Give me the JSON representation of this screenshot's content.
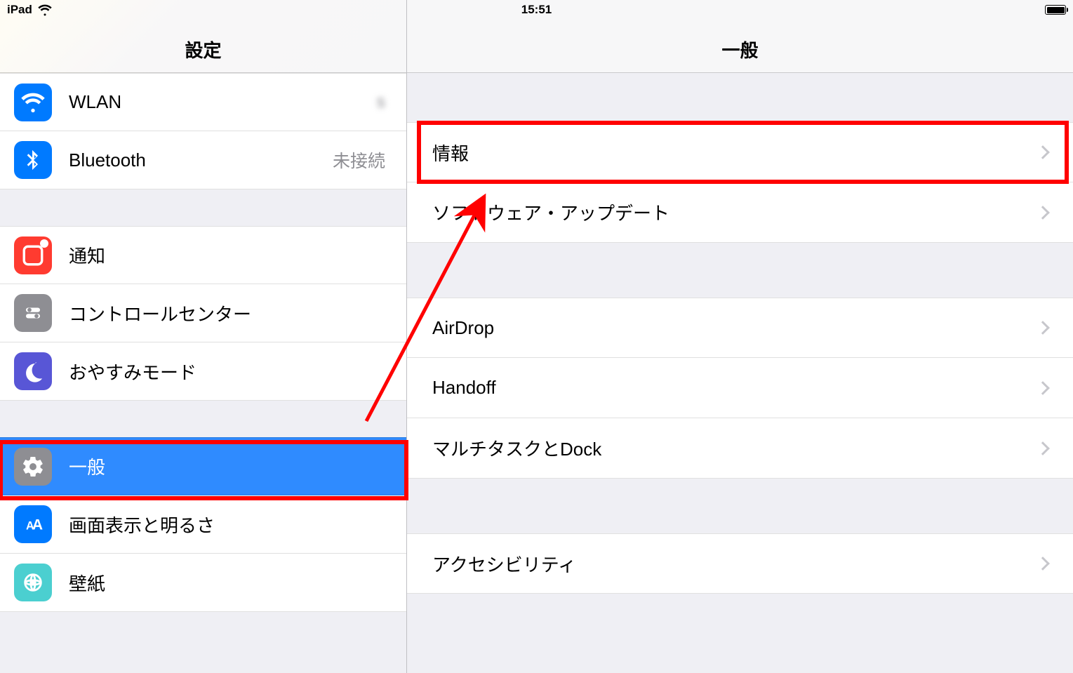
{
  "status": {
    "device": "iPad",
    "time": "15:51",
    "right_blurred": "               "
  },
  "sidebar": {
    "title": "設定",
    "groups": [
      {
        "items": [
          {
            "key": "wlan",
            "label": "WLAN",
            "value": "s         "
          },
          {
            "key": "bluetooth",
            "label": "Bluetooth",
            "value": "未接続"
          }
        ]
      },
      {
        "items": [
          {
            "key": "notifications",
            "label": "通知"
          },
          {
            "key": "controlcenter",
            "label": "コントロールセンター"
          },
          {
            "key": "dnd",
            "label": "おやすみモード"
          }
        ]
      },
      {
        "items": [
          {
            "key": "general",
            "label": "一般",
            "selected": true
          },
          {
            "key": "display",
            "label": "画面表示と明るさ"
          },
          {
            "key": "wallpaper",
            "label": "壁紙"
          }
        ]
      }
    ]
  },
  "detail": {
    "title": "一般",
    "groups": [
      {
        "items": [
          {
            "key": "about",
            "label": "情報"
          },
          {
            "key": "swupdate",
            "label": "ソフトウェア・アップデート"
          }
        ]
      },
      {
        "items": [
          {
            "key": "airdrop",
            "label": "AirDrop"
          },
          {
            "key": "handoff",
            "label": "Handoff"
          },
          {
            "key": "multitask",
            "label": "マルチタスクとDock"
          }
        ]
      },
      {
        "items": [
          {
            "key": "accessibility",
            "label": "アクセシビリティ"
          }
        ]
      }
    ]
  }
}
